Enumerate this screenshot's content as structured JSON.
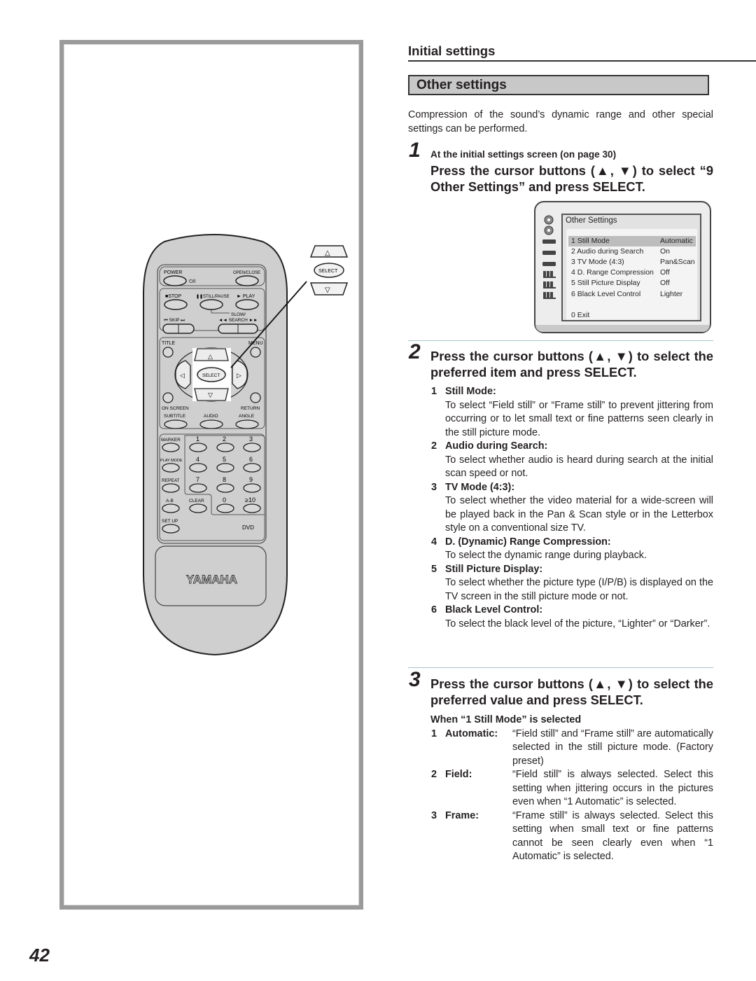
{
  "page": {
    "section": "Initial settings",
    "title": "Other settings",
    "intro": "Compression of the sound’s dynamic range and other special settings can be performed.",
    "page_number": "42"
  },
  "steps": [
    {
      "number": "1",
      "sub": "At the initial settings screen (on page 30)",
      "heading": "Press the cursor buttons (▲, ▼) to select “9 Other Settings” and press SELECT."
    },
    {
      "number": "2",
      "heading": "Press the cursor buttons (▲, ▼) to select the preferred item and press SELECT.",
      "items": [
        {
          "n": "1",
          "title": "Still Mode:",
          "desc": "To select “Field still” or “Frame still” to prevent jittering from occurring or to let small text or fine patterns seen clearly in the still picture mode."
        },
        {
          "n": "2",
          "title": "Audio during Search:",
          "desc": "To select whether audio is heard during search at the initial scan speed or not."
        },
        {
          "n": "3",
          "title": "TV Mode (4:3):",
          "desc": "To select whether the video material for a wide-screen will be played back in the Pan & Scan style or in the Letterbox style on a conventional size TV."
        },
        {
          "n": "4",
          "title": "D. (Dynamic) Range Compression:",
          "desc": "To select the dynamic range during playback."
        },
        {
          "n": "5",
          "title": "Still Picture Display:",
          "desc": "To select whether the picture type (I/P/B) is displayed on the TV screen in the still picture mode or not."
        },
        {
          "n": "6",
          "title": "Black Level Control:",
          "desc": "To select the black level of the picture, “Lighter” or “Darker”."
        }
      ]
    },
    {
      "number": "3",
      "heading": "Press the cursor buttons (▲, ▼) to select the preferred value and press SELECT.",
      "values_heading": "When “1 Still Mode” is selected",
      "values": [
        {
          "n": "1",
          "label": "Automatic:",
          "desc": "“Field still” and “Frame still” are automatically selected in the still picture mode. (Factory preset)"
        },
        {
          "n": "2",
          "label": "Field:",
          "desc": "“Field still” is always selected. Select this setting when jittering occurs in the pictures even when “1 Automatic” is selected."
        },
        {
          "n": "3",
          "label": "Frame:",
          "desc": "“Frame still” is always selected. Select this setting when small text or fine patterns cannot be seen clearly even when “1 Automatic” is selected."
        }
      ]
    }
  ],
  "osd": {
    "title": "Other Settings",
    "rows": [
      {
        "label": "1 Still Mode",
        "value": "Automatic",
        "highlighted": true
      },
      {
        "label": "2 Audio during Search",
        "value": "On"
      },
      {
        "label": "3 TV Mode (4:3)",
        "value": "Pan&Scan"
      },
      {
        "label": "4 D. Range Compression",
        "value": "Off"
      },
      {
        "label": "5 Still Picture Display",
        "value": "Off"
      },
      {
        "label": "6 Black Level Control",
        "value": "Lighter"
      }
    ],
    "exit": "0 Exit",
    "side_icons": [
      "disc-icon",
      "disc-icon",
      "player-icon",
      "player-icon",
      "player-icon",
      "speakers-icon",
      "speakers-icon",
      "speakers-icon"
    ]
  },
  "remote": {
    "brand": "YAMAHA",
    "model_label": "DVD",
    "callout": {
      "up": "△",
      "select": "SELECT",
      "down": "▽"
    },
    "labels": {
      "power": "POWER",
      "power_symbol": "⏻/I",
      "open_close": "OPEN/CLOSE",
      "stop": "■STOP",
      "still_pause": "❚❚STILL/PAUSE",
      "play": "► PLAY",
      "slow_search": "SLOW/",
      "search": "◄◄ SEARCH ►►",
      "skip": "⏮  SKIP  ⏭",
      "title": "TITLE",
      "menu": "MENU",
      "select": "SELECT",
      "up": "△",
      "down": "▽",
      "left": "◁",
      "right": "▷",
      "on_screen": "ON SCREEN",
      "return": "RETURN",
      "subtitle": "SUBTITLE",
      "audio": "AUDIO",
      "angle": "ANGLE",
      "marker": "MARKER",
      "play_mode": "PLAY MODE",
      "repeat": "REPEAT",
      "ab": "A-B",
      "clear": "CLEAR",
      "setup": "SET UP",
      "digits": [
        "1",
        "2",
        "3",
        "4",
        "5",
        "6",
        "7",
        "8",
        "9",
        "0",
        "≥10"
      ]
    }
  }
}
